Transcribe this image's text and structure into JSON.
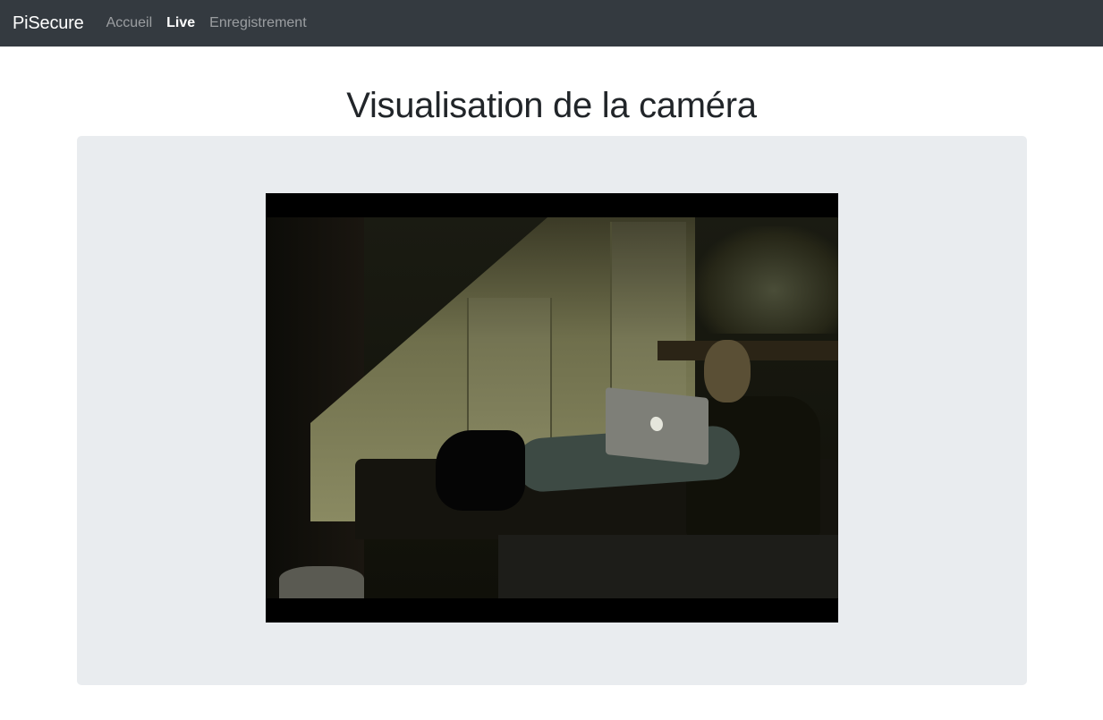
{
  "navbar": {
    "brand": "PiSecure",
    "links": [
      {
        "label": "Accueil",
        "active": false
      },
      {
        "label": "Live",
        "active": true
      },
      {
        "label": "Enregistrement",
        "active": false
      }
    ]
  },
  "main": {
    "title": "Visualisation de la caméra"
  },
  "colors": {
    "navbar_bg": "#343a40",
    "jumbotron_bg": "#e9ecef",
    "title_text": "#212529"
  }
}
